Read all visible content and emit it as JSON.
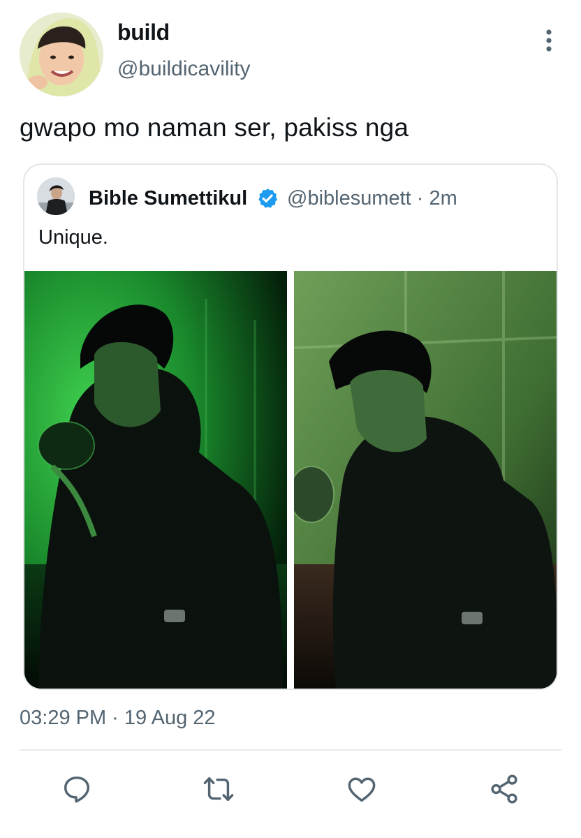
{
  "tweet": {
    "author": {
      "name": "build",
      "handle": "@buildicavility"
    },
    "text": "gwapo mo naman ser, pakiss nga",
    "timestamp": "03:29 PM · 19 Aug 22",
    "more_icon": "more-vertical-icon"
  },
  "quoted": {
    "name": "Bible Sumettikul",
    "verified_icon": "verified-badge-icon",
    "handle_time": "@biblesumett · 2m",
    "text": "Unique.",
    "photos": [
      "photo-1",
      "photo-2"
    ]
  },
  "actions": {
    "icons": [
      "reply-icon",
      "retweet-icon",
      "like-icon",
      "share-icon"
    ]
  },
  "colors": {
    "text_primary": "#0f1419",
    "text_secondary": "#536471",
    "verified_blue": "#1d9bf0",
    "border": "#e3e7ea",
    "photo_green": "#1e8f35"
  }
}
